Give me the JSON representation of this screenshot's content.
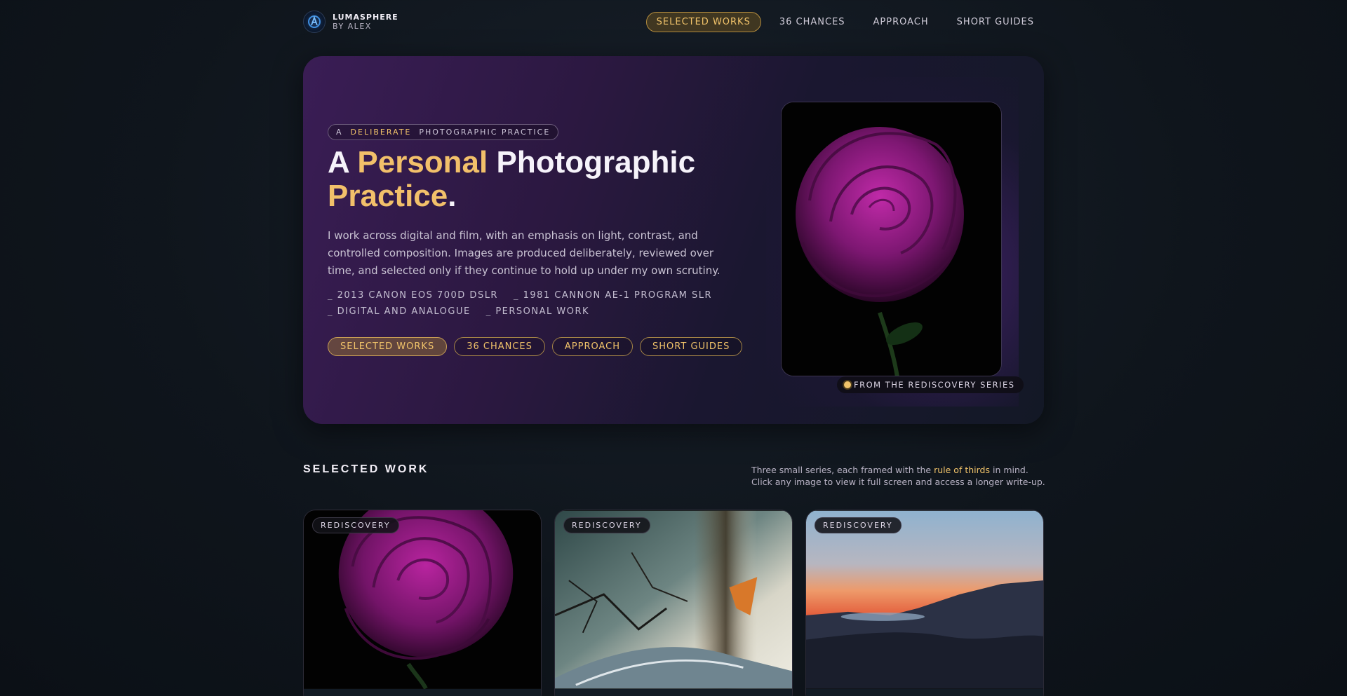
{
  "brand": {
    "name": "LUMASPHERE",
    "subtitle": "BY ALEX"
  },
  "nav": {
    "items": [
      {
        "label": "SELECTED WORKS",
        "active": true
      },
      {
        "label": "36 CHANCES",
        "active": false
      },
      {
        "label": "APPROACH",
        "active": false
      },
      {
        "label": "SHORT GUIDES",
        "active": false
      }
    ]
  },
  "hero": {
    "eyebrow": {
      "prefix": "A",
      "emphasis": "DELIBERATE",
      "suffix": "PHOTOGRAPHIC PRACTICE"
    },
    "title": {
      "part1": "A",
      "part2": "Personal",
      "part3": "Photographic",
      "part4": "Practice",
      "part5": "."
    },
    "description": "I work across digital and film, with an emphasis on light, contrast, and controlled composition. Images are produced deliberately, reviewed over time, and selected only if they continue to hold up under my own scrutiny.",
    "tags": [
      "2013 CANON EOS 700D DSLR",
      "1981 CANNON AE-1 PROGRAM SLR",
      "DIGITAL AND ANALOGUE",
      "PERSONAL WORK"
    ],
    "buttons": [
      {
        "label": "SELECTED WORKS",
        "active": true
      },
      {
        "label": "36 CHANCES",
        "active": false
      },
      {
        "label": "APPROACH",
        "active": false
      },
      {
        "label": "SHORT GUIDES",
        "active": false
      }
    ],
    "image_caption": "FROM THE REDISCOVERY SERIES"
  },
  "selected_work": {
    "title": "SELECTED WORK",
    "description": {
      "before": "Three small series, each framed with the",
      "highlight": "rule of thirds",
      "after": "in mind. Click any image to view it full screen and access a longer write-up."
    },
    "cards": [
      {
        "badge": "REDISCOVERY",
        "subject": "rose"
      },
      {
        "badge": "REDISCOVERY",
        "subject": "glass"
      },
      {
        "badge": "REDISCOVERY",
        "subject": "sunset"
      }
    ]
  },
  "colors": {
    "accent": "#f1c36a",
    "hero_purple": "#3a1d55",
    "background": "#0f151c"
  }
}
